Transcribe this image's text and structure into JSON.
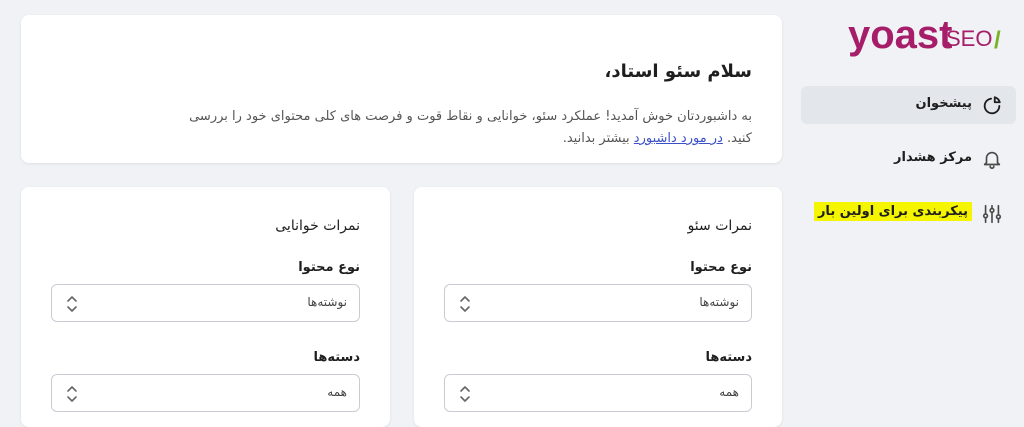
{
  "brand": {
    "logo_text": "yoast",
    "logo_suffix": "SEO",
    "logo_slash": "/",
    "colors": {
      "brand": "#a61e69",
      "accent": "#77b227",
      "highlight": "#f5f500"
    }
  },
  "sidebar": {
    "items": [
      {
        "label": "پیشخوان",
        "icon": "dashboard-gauge-icon",
        "active": true
      },
      {
        "label": "مرکز هشدار",
        "icon": "bell-icon",
        "active": false
      },
      {
        "label": "پیکربندی برای اولین بار",
        "icon": "sliders-icon",
        "active": false
      }
    ]
  },
  "welcome": {
    "title": "سلام سئو استاد،",
    "line1": "به داشبوردتان خوش آمدید! عملکرد سئو، خوانایی و نقاط قوت و فرصت های کلی محتوای خود را بررسی",
    "line2_before": "کنید.",
    "link": "در مورد داشبورد",
    "line2_after": "بیشتر بدانید."
  },
  "seo_scores": {
    "title": "نمرات سئو",
    "content_type_label": "نوع محتوا",
    "content_type_value": "نوشته‌ها",
    "category_label": "دسته‌ها",
    "category_value": "همه"
  },
  "readability_scores": {
    "title": "نمرات خوانایی",
    "content_type_label": "نوع محتوا",
    "content_type_value": "نوشته‌ها",
    "category_label": "دسته‌ها",
    "category_value": "همه"
  }
}
